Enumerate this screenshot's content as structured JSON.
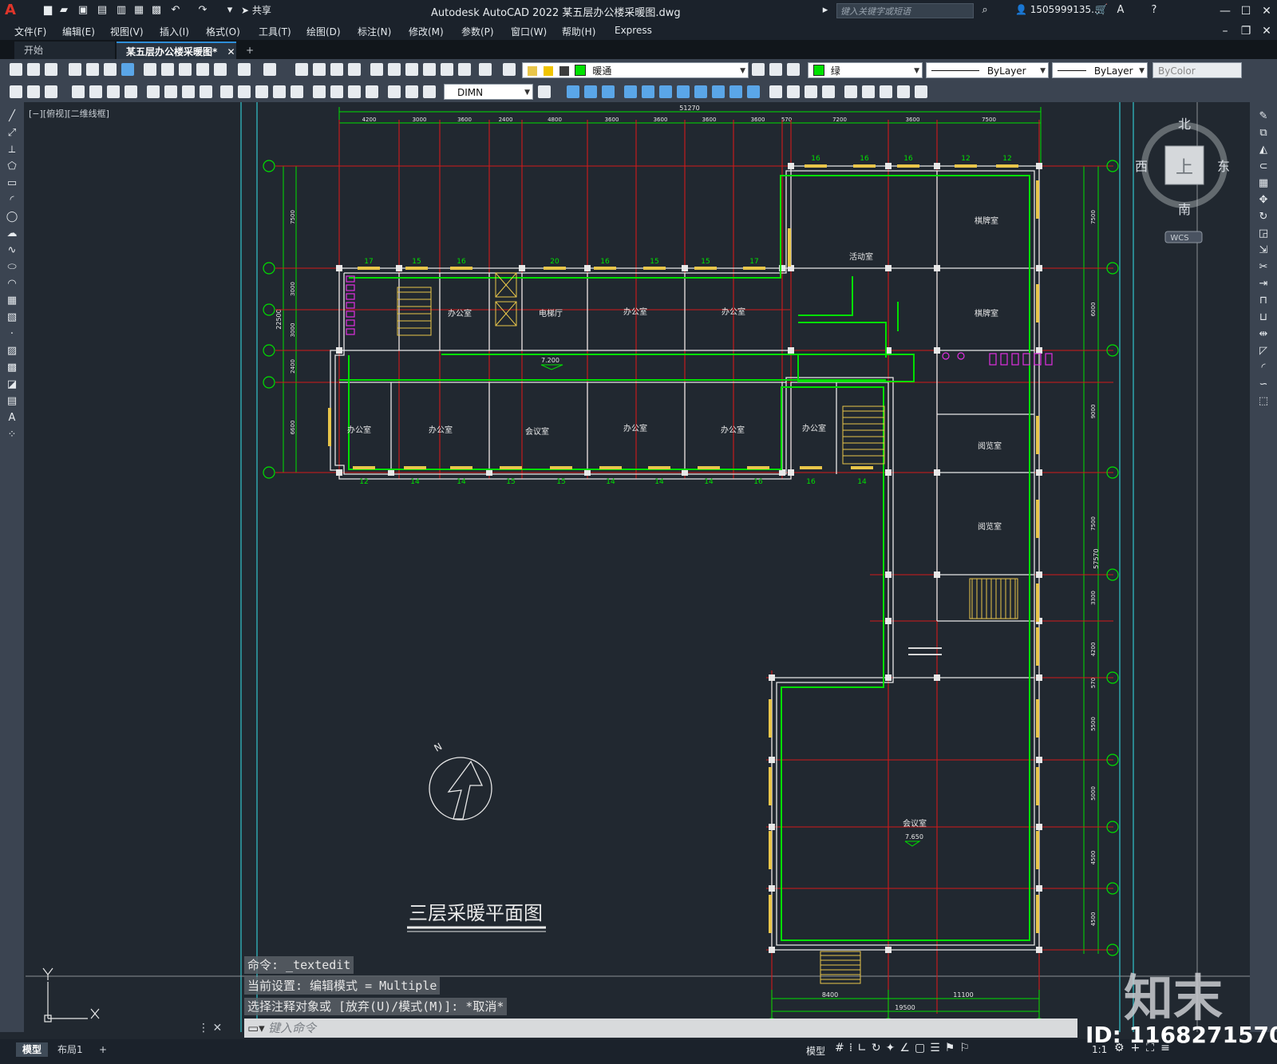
{
  "app": {
    "logo": "A",
    "share": "共享",
    "title": "Autodesk AutoCAD 2022    某五层办公楼采暖图.dwg",
    "search_placeholder": "键入关键字或短语",
    "user": "1505999135..."
  },
  "menu": [
    "文件(F)",
    "编辑(E)",
    "视图(V)",
    "插入(I)",
    "格式(O)",
    "工具(T)",
    "绘图(D)",
    "标注(N)",
    "修改(M)",
    "参数(P)",
    "窗口(W)",
    "帮助(H)",
    "Express"
  ],
  "tabs": {
    "start": "开始",
    "doc": "某五层办公楼采暖图*",
    "add": "+"
  },
  "toolbar": {
    "layer": "暖通",
    "color": "绿",
    "linetype": "ByLayer",
    "lineweight": "ByLayer",
    "plotstyle": "ByColor",
    "dimstyle": "DIMN"
  },
  "viewport_label": "[−][俯视][二维线框]",
  "viewcube": {
    "north": "北",
    "south": "南",
    "east": "东",
    "west": "西",
    "top": "上",
    "wcs": "WCS"
  },
  "drawing": {
    "title": "三层采暖平面图",
    "north_label": "N",
    "overall_dim": "51270",
    "top_dims": [
      "4200",
      "3000",
      "3600",
      "2400",
      "4800",
      "3600",
      "3600",
      "3600",
      "3600",
      "570",
      "7200",
      "3600",
      "7500"
    ],
    "left_dims": [
      "7500",
      "3000",
      "3000",
      "2400",
      "6600"
    ],
    "left_total": "22500",
    "right_dims": [
      "7500",
      "6000",
      "9000",
      "7500",
      "3300",
      "4200",
      "570",
      "5500",
      "5000",
      "4500",
      "4500"
    ],
    "right_total": "57570",
    "bottom_dims": [
      "8400",
      "11100"
    ],
    "bottom_total": "19500",
    "elev_1": "7.200",
    "elev_2": "7.650",
    "rooms": {
      "office": "办公室",
      "elevator_hall": "电梯厅",
      "meeting": "会议室",
      "activity": "活动室",
      "chess": "棋牌室",
      "reading": "阅览室"
    },
    "radiator_top_row": [
      "17",
      "15",
      "16",
      "20",
      "16",
      "15",
      "15",
      "17"
    ],
    "radiator_top_right": [
      "16",
      "16",
      "16",
      "12",
      "12"
    ],
    "radiator_bottom_row": [
      "12",
      "14",
      "14",
      "15",
      "15",
      "14",
      "14",
      "14",
      "16",
      "16",
      "14"
    ]
  },
  "command": {
    "line1": "命令: _textedit",
    "line2": "当前设置: 编辑模式 = Multiple",
    "line3": "选择注释对象或 [放弃(U)/模式(M)]: *取消*",
    "input_placeholder": "键入命令"
  },
  "layout_tabs": {
    "model": "模型",
    "layout1": "布局1",
    "add": "+"
  },
  "status": {
    "model": "模型",
    "scale": "1:1"
  },
  "watermark": {
    "logo": "知末",
    "id": "ID: 1168271570"
  }
}
